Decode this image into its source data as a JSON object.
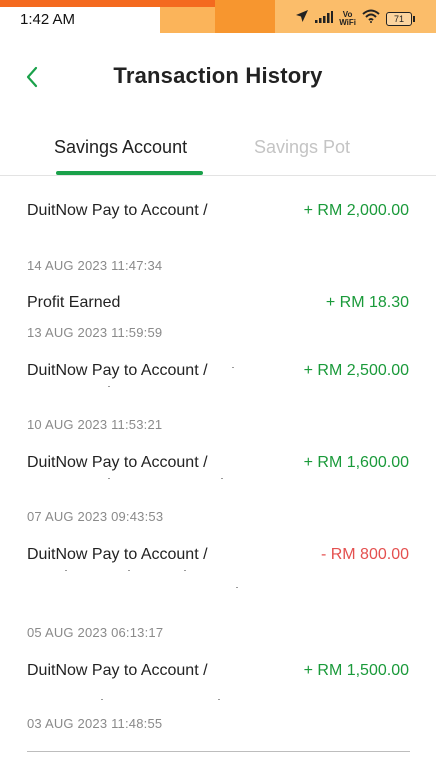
{
  "status_bar": {
    "time": "1:42 AM",
    "network_label": "Vo\nWiFi",
    "battery": "71"
  },
  "header": {
    "title": "Transaction History"
  },
  "tabs": [
    {
      "label": "Savings Account",
      "active": true
    },
    {
      "label": "Savings Pot",
      "active": false
    }
  ],
  "transactions": [
    {
      "title": "DuitNow Pay to Account /",
      "amount": "+ RM 2,000.00",
      "type": "credit",
      "date": "14 AUG 2023 11:47:34"
    },
    {
      "title": "Profit Earned",
      "amount": "+ RM 18.30",
      "type": "credit",
      "date": "13 AUG 2023 11:59:59"
    },
    {
      "title": "DuitNow Pay to Account /",
      "amount": "+ RM 2,500.00",
      "type": "credit",
      "date": "10 AUG 2023 11:53:21"
    },
    {
      "title": "DuitNow Pay to Account /",
      "amount": "+ RM 1,600.00",
      "type": "credit",
      "date": "07 AUG 2023 09:43:53"
    },
    {
      "title": "DuitNow Pay to Account /",
      "amount": "- RM 800.00",
      "type": "debit",
      "date": "05 AUG 2023 06:13:17"
    },
    {
      "title": "DuitNow Pay to Account /",
      "amount": "+ RM 1,500.00",
      "type": "credit",
      "date": "03 AUG 2023 11:48:55"
    }
  ],
  "colors": {
    "accent_green": "#1aa14a",
    "credit_green": "#1a9a3a",
    "debit_red": "#e4504f",
    "status_orange": "#f46a1f"
  },
  "icons": [
    "back-arrow-icon",
    "location-arrow-icon",
    "signal-bars-icon",
    "wifi-icon",
    "battery-icon"
  ]
}
